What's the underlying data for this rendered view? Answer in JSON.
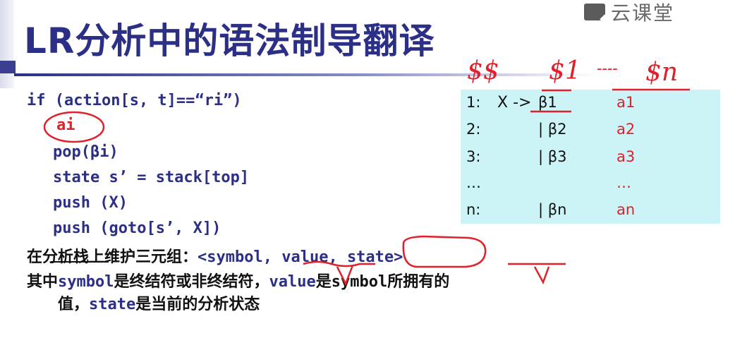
{
  "title": "LR分析中的语法制导翻译",
  "watermark": {
    "icon": "cloud-classroom-logo-icon",
    "text": "云课堂"
  },
  "code": {
    "if_line": "if (action[s, t]==“ri”)",
    "ai": "ai",
    "pop": "pop(βi)",
    "state": "state s’ = stack[top]",
    "push_x": "push (X)",
    "push_goto": "push (goto[s’, X])"
  },
  "grammar": {
    "rows": [
      {
        "num": "1:",
        "lhs": "X ->",
        "rhs": "β1",
        "action": "a1"
      },
      {
        "num": "2:",
        "lhs": "",
        "rhs": "| β2",
        "action": "a2"
      },
      {
        "num": "3:",
        "lhs": "",
        "rhs": "| β3",
        "action": "a3"
      },
      {
        "num": "…",
        "lhs": "",
        "rhs": "",
        "action": "…"
      },
      {
        "num": "n:",
        "lhs": "",
        "rhs": "| βn",
        "action": "an"
      }
    ]
  },
  "text": {
    "line1_a": "在分析栈上维护三元组：",
    "line1_b": "<symbol, value, state>",
    "line2_a": "其中",
    "line2_b": "symbol",
    "line2_c": "是终结符或非终结符，",
    "line2_d": "value",
    "line2_e": "是",
    "line2_f": "symbol",
    "line2_g": "所拥有的",
    "line3_a": "值，",
    "line3_b": "state",
    "line3_c": "是当前的分析状态"
  },
  "annotations": {
    "dollar_dollar": "$$",
    "dollar_1": "$1",
    "dots": "----",
    "dollar_n": "$n"
  },
  "colors": {
    "title": "#2b2f86",
    "code": "#2b2f86",
    "accent_red": "#e0202a",
    "box": "#ccf4f6"
  }
}
